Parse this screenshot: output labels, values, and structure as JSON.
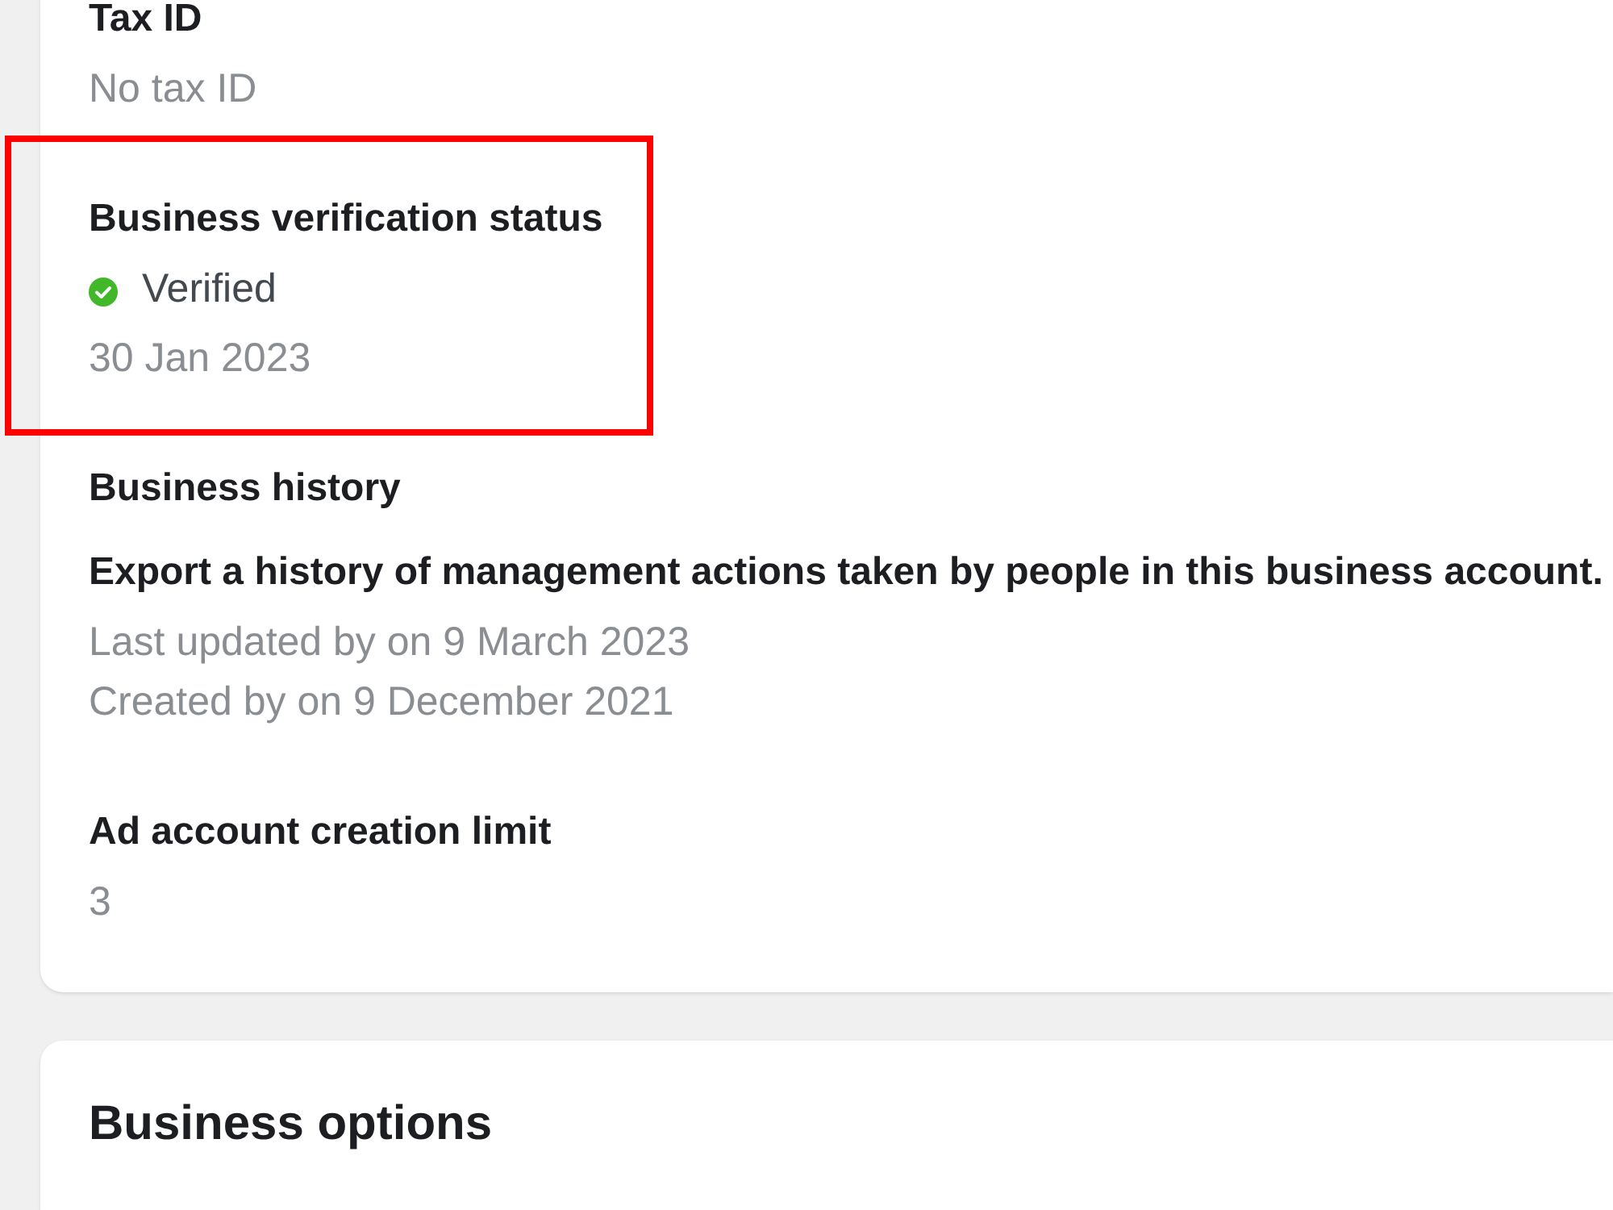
{
  "info_card": {
    "fields": [
      {
        "label": "Tax ID",
        "lines": [
          "No tax ID"
        ],
        "highlighted": false
      },
      {
        "label": "Business verification status",
        "status": "Verified",
        "lines": [
          "30 Jan 2023"
        ],
        "highlighted": true
      },
      {
        "label": "Business history",
        "description": "Export a history of management actions taken by people in this business account.",
        "lines": [
          "Last updated by on 9 March 2023",
          "Created by on 9 December 2021"
        ],
        "highlighted": false
      },
      {
        "label": "Ad account creation limit",
        "lines": [
          "3"
        ],
        "highlighted": false
      }
    ]
  },
  "options_card": {
    "title": "Business options"
  }
}
